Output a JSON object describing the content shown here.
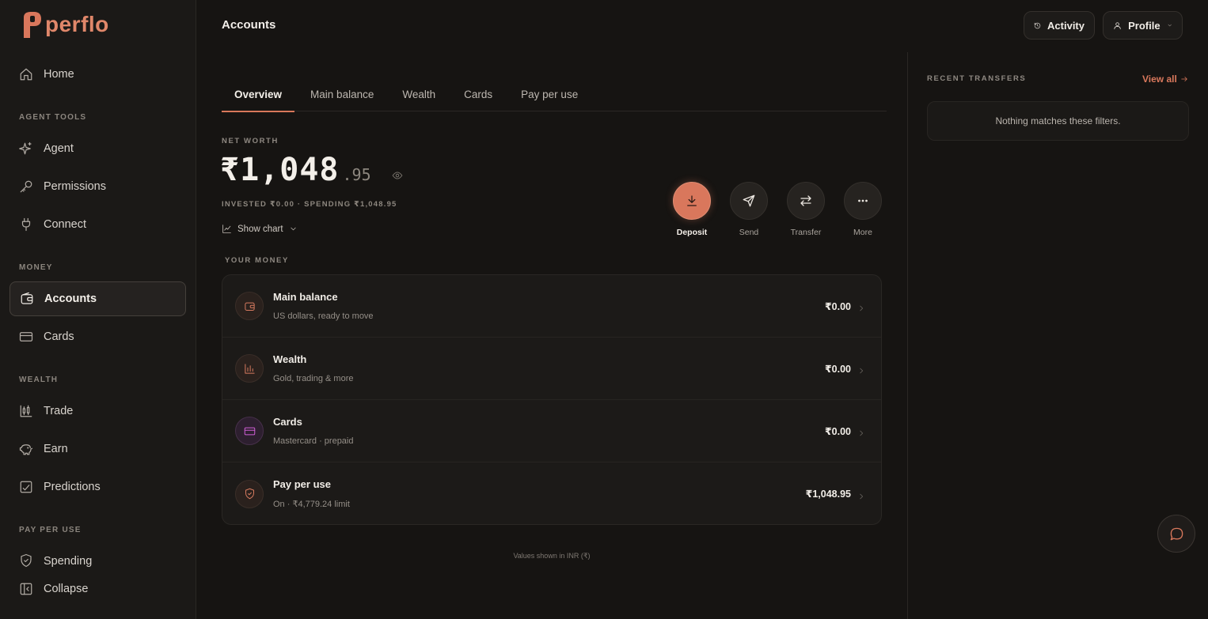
{
  "brand": {
    "name": "perflo",
    "accent": "#d9775c"
  },
  "sidebar": {
    "items": [
      {
        "label": "Home",
        "icon": "home-icon"
      },
      {
        "label": "Agent",
        "icon": "sparkle-icon"
      },
      {
        "label": "Permissions",
        "icon": "key-icon"
      },
      {
        "label": "Connect",
        "icon": "plug-icon"
      },
      {
        "label": "Accounts",
        "icon": "wallet-icon",
        "active": true
      },
      {
        "label": "Cards",
        "icon": "credit-card-icon"
      },
      {
        "label": "Trade",
        "icon": "candlestick-icon"
      },
      {
        "label": "Earn",
        "icon": "piggy-bank-icon"
      },
      {
        "label": "Predictions",
        "icon": "chart-check-icon"
      },
      {
        "label": "Spending",
        "icon": "shield-check-icon"
      }
    ],
    "sections": [
      "AGENT TOOLS",
      "MONEY",
      "WEALTH",
      "PAY PER USE"
    ],
    "collapse_label": "Collapse"
  },
  "header": {
    "title": "Accounts",
    "activity_label": "Activity",
    "profile_label": "Profile"
  },
  "tabs": [
    "Overview",
    "Main balance",
    "Wealth",
    "Cards",
    "Pay per use"
  ],
  "net_worth": {
    "label": "NET WORTH",
    "main": "₹1,048",
    "decimals": ".95",
    "sub": "INVESTED ₹0.00 · SPENDING ₹1,048.95",
    "show_chart_label": "Show chart"
  },
  "actions": [
    {
      "label": "Deposit",
      "icon": "download-icon"
    },
    {
      "label": "Send",
      "icon": "send-icon"
    },
    {
      "label": "Transfer",
      "icon": "transfer-icon"
    },
    {
      "label": "More",
      "icon": "more-icon"
    }
  ],
  "your_money": {
    "label": "YOUR MONEY",
    "rows": [
      {
        "title": "Main balance",
        "subtitle": "US dollars, ready to move",
        "amount": "₹0.00",
        "icon": "wallet-icon"
      },
      {
        "title": "Wealth",
        "subtitle": "Gold, trading & more",
        "amount": "₹0.00",
        "icon": "bar-chart-icon"
      },
      {
        "title": "Cards",
        "subtitle": "Mastercard · prepaid",
        "amount": "₹0.00",
        "icon": "credit-card-icon"
      },
      {
        "title": "Pay per use",
        "subtitle": "On · ₹4,779.24 limit",
        "amount": "₹1,048.95",
        "icon": "shield-check-icon"
      }
    ]
  },
  "footnote": "Values shown in INR (₹)",
  "recent_transfers": {
    "label": "RECENT TRANSFERS",
    "view_all_label": "View all",
    "empty_text": "Nothing matches these filters."
  }
}
